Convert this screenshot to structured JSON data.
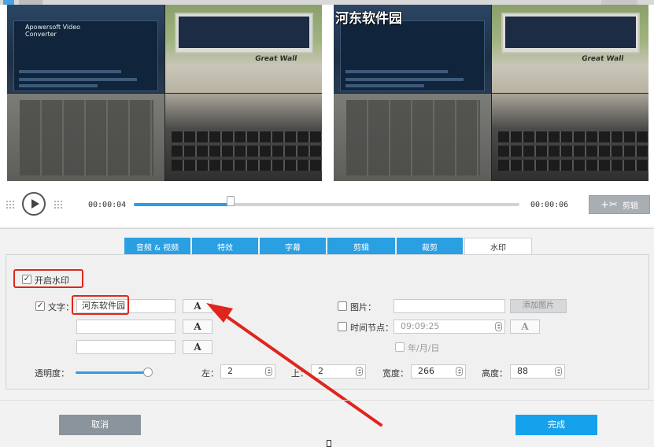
{
  "preview": {
    "left_app_title": "Apowersoft Video Converter",
    "brand_label_left": "Great Wall",
    "brand_label_right": "Great Wall",
    "watermark_text": "河东软件园"
  },
  "playback": {
    "current_time": "00:00:04",
    "total_time": "00:00:06",
    "progress": 0.25,
    "cut_label": "剪辑"
  },
  "tabs": [
    {
      "label": "音频 & 视频",
      "active": false
    },
    {
      "label": "特效",
      "active": false
    },
    {
      "label": "字幕",
      "active": false
    },
    {
      "label": "剪辑",
      "active": false
    },
    {
      "label": "裁剪",
      "active": false
    },
    {
      "label": "水印",
      "active": true
    }
  ],
  "watermark": {
    "enable_label": "开启水印",
    "enable_checked": true,
    "text_label": "文字：",
    "text_checked": true,
    "text_values": [
      "河东软件园",
      "",
      ""
    ],
    "font_button_glyph": "A",
    "image_label": "图片：",
    "image_checked": false,
    "image_path": "",
    "add_image_label": "添加图片",
    "time_label": "时间节点：",
    "time_checked": false,
    "time_value": "09:09:25",
    "date_format_label": "年/月/日",
    "opacity_label": "透明度：",
    "opacity_value": 1.0,
    "left_label": "左：",
    "left_value": "2",
    "top_label": "上：",
    "top_value": "2",
    "width_label": "宽度：",
    "width_value": "266",
    "height_label": "高度：",
    "height_value": "88"
  },
  "footer": {
    "cancel_label": "取消",
    "done_label": "完成"
  },
  "colors": {
    "accent": "#2a9fe2",
    "done_button": "#16a1ec",
    "cancel_button": "#8b939c",
    "annotation_red": "#e0251d"
  }
}
